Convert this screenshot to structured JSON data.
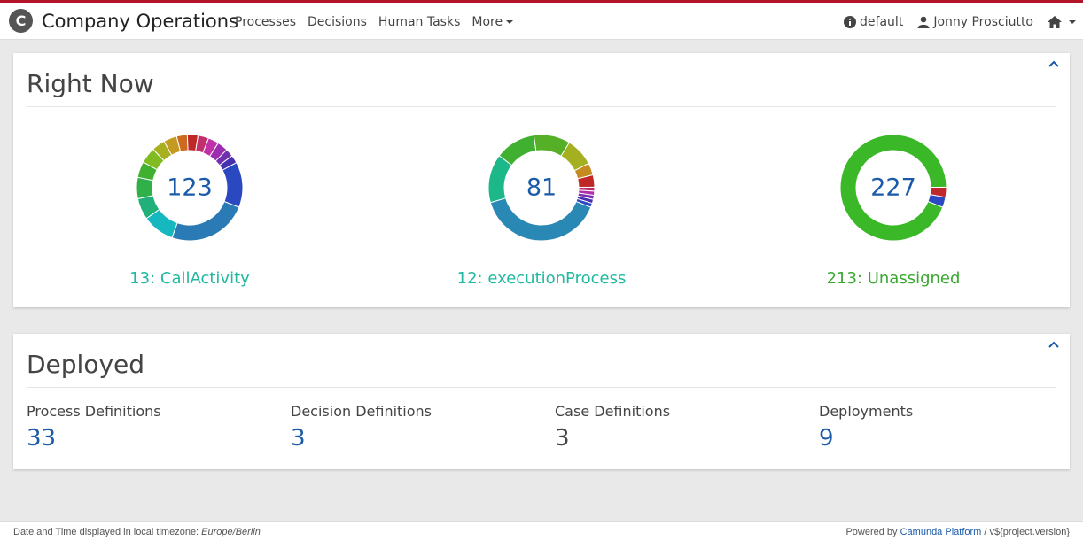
{
  "header": {
    "logo_letter": "C",
    "title": "Company Operations",
    "nav": [
      "Processes",
      "Decisions",
      "Human Tasks",
      "More"
    ],
    "engine": "default",
    "user": "Jonny Prosciutto"
  },
  "right_now": {
    "title": "Right Now",
    "charts": [
      {
        "total": "123",
        "label": "13: CallActivity",
        "label_color": "#20b8a0",
        "segments": [
          {
            "value": 30,
            "color": "#2a7ab5"
          },
          {
            "value": 12,
            "color": "#16b8c0"
          },
          {
            "value": 8,
            "color": "#22b07a"
          },
          {
            "value": 8,
            "color": "#30b048"
          },
          {
            "value": 6,
            "color": "#40b030"
          },
          {
            "value": 6,
            "color": "#80bb20"
          },
          {
            "value": 5,
            "color": "#a8b020"
          },
          {
            "value": 5,
            "color": "#c59a20"
          },
          {
            "value": 4,
            "color": "#cc6a20"
          },
          {
            "value": 4,
            "color": "#c02828"
          },
          {
            "value": 4,
            "color": "#c0306a"
          },
          {
            "value": 4,
            "color": "#c030a8"
          },
          {
            "value": 4,
            "color": "#9c2cb0"
          },
          {
            "value": 3,
            "color": "#7030b0"
          },
          {
            "value": 3,
            "color": "#4530b0"
          },
          {
            "value": 17,
            "color": "#2a48c0"
          }
        ]
      },
      {
        "total": "81",
        "label": "12: executionProcess",
        "label_color": "#20b8a0",
        "segments": [
          {
            "value": 32,
            "color": "#2a88b5"
          },
          {
            "value": 12,
            "color": "#1cb88a"
          },
          {
            "value": 10,
            "color": "#40b030"
          },
          {
            "value": 9,
            "color": "#55b028"
          },
          {
            "value": 7,
            "color": "#a5b020"
          },
          {
            "value": 3,
            "color": "#c58a20"
          },
          {
            "value": 3,
            "color": "#c02828"
          },
          {
            "value": 1,
            "color": "#c02a6a"
          },
          {
            "value": 1,
            "color": "#b030a8"
          },
          {
            "value": 1,
            "color": "#7a30b0"
          },
          {
            "value": 1,
            "color": "#4a30b0"
          },
          {
            "value": 1,
            "color": "#2a48c0"
          }
        ]
      },
      {
        "total": "227",
        "label": "213: Unassigned",
        "label_color": "#3aa830",
        "segments": [
          {
            "value": 213,
            "color": "#3ab828"
          },
          {
            "value": 7,
            "color": "#c0282f"
          },
          {
            "value": 7,
            "color": "#2a48c0"
          }
        ]
      }
    ]
  },
  "deployed": {
    "title": "Deployed",
    "items": [
      {
        "label": "Process Definitions",
        "value": "33",
        "link": true
      },
      {
        "label": "Decision Definitions",
        "value": "3",
        "link": true
      },
      {
        "label": "Case Definitions",
        "value": "3",
        "link": false
      },
      {
        "label": "Deployments",
        "value": "9",
        "link": true
      }
    ]
  },
  "footer": {
    "timezone_prefix": "Date and Time displayed in local timezone: ",
    "timezone": "Europe/Berlin",
    "powered_prefix": "Powered by ",
    "powered_link": "Camunda Platform",
    "version": " / v${project.version}"
  },
  "colors": {
    "accent": "#b5152b",
    "link": "#1a5aa8"
  }
}
